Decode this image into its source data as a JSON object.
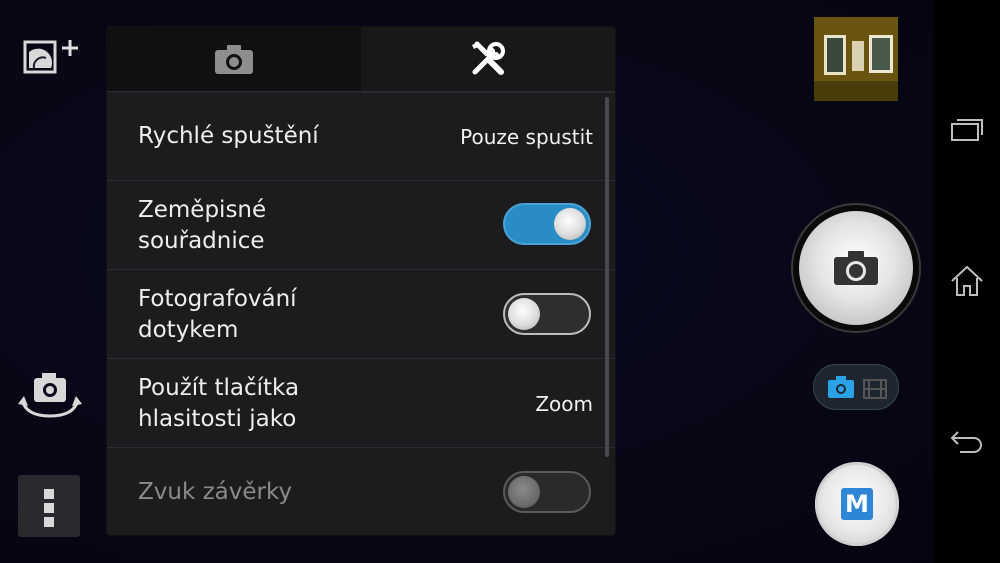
{
  "tabs": [
    {
      "icon": "camera-icon"
    },
    {
      "icon": "tools-icon"
    }
  ],
  "settings": [
    {
      "label": "Rychlé spuštění",
      "value": "Pouze spustit"
    },
    {
      "label": "Zeměpisné\nsouřadnice",
      "toggle": "on"
    },
    {
      "label": "Fotografování\ndotykem",
      "toggle": "off"
    },
    {
      "label": "Použít tlačítka\nhlasitosti jako",
      "value": "Zoom"
    },
    {
      "label": "Zvuk závěrky",
      "toggle": "disabled"
    }
  ],
  "mode_button": {
    "label": "M"
  },
  "colors": {
    "accent": "#2a8cc4",
    "mode_blue": "#2e87d6",
    "panel": "#1c1c1e"
  },
  "icons": {
    "top_left": "scene-hdr-plus-icon",
    "switch_camera": "switch-camera-icon",
    "menu": "more-menu-icon",
    "shutter": "camera-icon",
    "mode_toggle": [
      "camera-icon",
      "video-icon"
    ],
    "nav": [
      "recent-apps-icon",
      "home-icon",
      "back-icon"
    ]
  }
}
